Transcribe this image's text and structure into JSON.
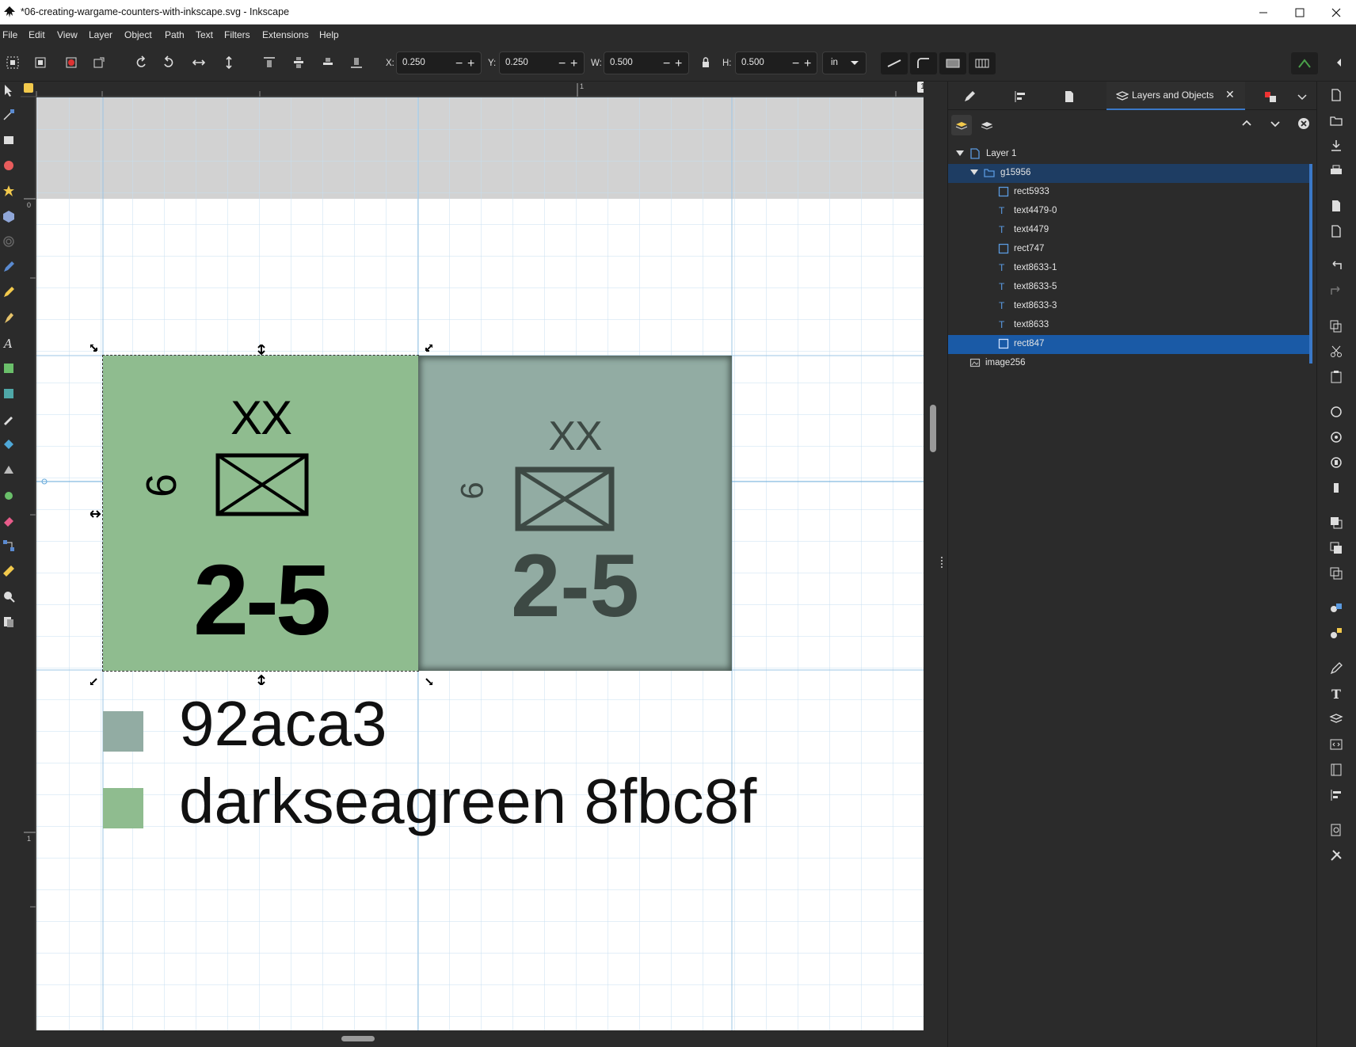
{
  "window": {
    "title": "*06-creating-wargame-counters-with-inkscape.svg - Inkscape"
  },
  "menu": [
    "File",
    "Edit",
    "View",
    "Layer",
    "Object",
    "Path",
    "Text",
    "Filters",
    "Extensions",
    "Help"
  ],
  "toolbar": {
    "x_label": "X:",
    "x_value": "0.250",
    "y_label": "Y:",
    "y_value": "0.250",
    "w_label": "W:",
    "w_value": "0.500",
    "h_label": "H:",
    "h_value": "0.500",
    "unit": "in",
    "page_number": "1"
  },
  "rulers": {
    "top_label": "1",
    "left_labels": [
      "0",
      "1"
    ]
  },
  "canvas": {
    "counter_new": {
      "fill": "#8fbc8f",
      "size": "XX",
      "unit_number": "6",
      "strength": "2-5"
    },
    "counter_original": {
      "fill": "#92aca3",
      "size": "XX",
      "unit_number": "6",
      "strength": "2-5"
    },
    "swatches": [
      {
        "color": "#92aca3",
        "label": "92aca3"
      },
      {
        "color": "#8fbc8f",
        "label": "darkseagreen 8fbc8f"
      }
    ]
  },
  "dock": {
    "active_tab": "Layers and Objects",
    "tree": [
      {
        "label": "Layer 1",
        "type": "layer",
        "level": 0,
        "expanded": true,
        "state": ""
      },
      {
        "label": "g15956",
        "type": "group",
        "level": 1,
        "expanded": true,
        "state": "parent"
      },
      {
        "label": "rect5933",
        "type": "rect",
        "level": 2,
        "state": ""
      },
      {
        "label": "text4479-0",
        "type": "text",
        "level": 2,
        "state": ""
      },
      {
        "label": "text4479",
        "type": "text",
        "level": 2,
        "state": ""
      },
      {
        "label": "rect747",
        "type": "rect",
        "level": 2,
        "state": ""
      },
      {
        "label": "text8633-1",
        "type": "text",
        "level": 2,
        "state": ""
      },
      {
        "label": "text8633-5",
        "type": "text",
        "level": 2,
        "state": ""
      },
      {
        "label": "text8633-3",
        "type": "text",
        "level": 2,
        "state": ""
      },
      {
        "label": "text8633",
        "type": "text",
        "level": 2,
        "state": ""
      },
      {
        "label": "rect847",
        "type": "rect",
        "level": 2,
        "state": "selected"
      },
      {
        "label": "image256",
        "type": "image",
        "level": 0,
        "state": ""
      }
    ]
  },
  "colors": {
    "accent": "#3a78c8",
    "selection": "#1a5aa6",
    "darkseagreen": "#8fbc8f",
    "scanned_counter": "#92aca3"
  }
}
